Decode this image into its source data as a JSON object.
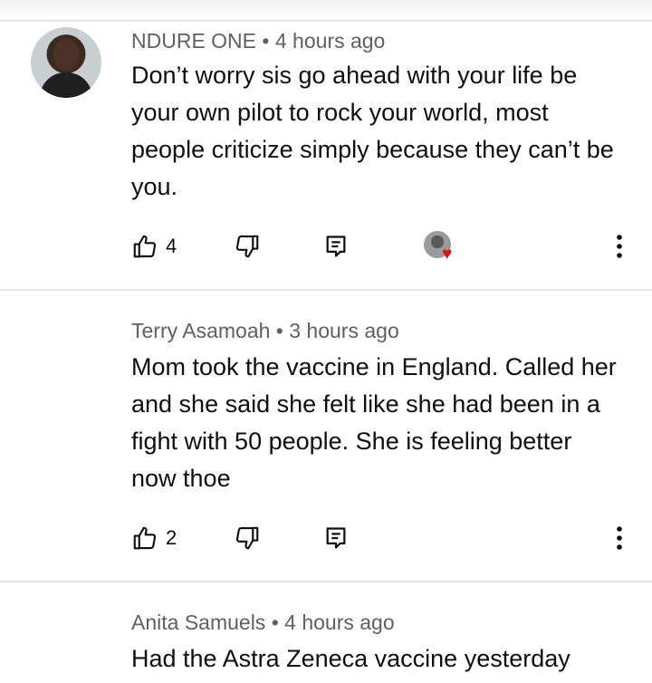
{
  "comments": [
    {
      "author": "NDURE ONE",
      "separator": "•",
      "time": "4 hours ago",
      "text": "Don’t worry sis go ahead with your life be your own pilot to rock your world, most people criticize simply because they can’t be you.",
      "likes": "4",
      "creator_heart": true,
      "icons": [
        "like-icon",
        "dislike-icon",
        "reply-icon",
        "creator-heart-icon",
        "more-options-icon"
      ]
    },
    {
      "author": "Terry Asamoah",
      "separator": "•",
      "time": "3 hours ago",
      "text": "Mom took the vaccine in England. Called her and she said she felt like she had been in a fight with 50 people. She is feeling better now thoe",
      "likes": "2",
      "creator_heart": false,
      "icons": [
        "like-icon",
        "dislike-icon",
        "reply-icon",
        "more-options-icon"
      ]
    },
    {
      "author": "Anita Samuels",
      "separator": "•",
      "time": "4 hours ago",
      "text": "Had the Astra Zeneca vaccine yesterday"
    }
  ],
  "colors": {
    "meta_text": "#606060",
    "body_text": "#0f0f0f",
    "divider": "#e5e5e5",
    "heart": "#e01212"
  }
}
